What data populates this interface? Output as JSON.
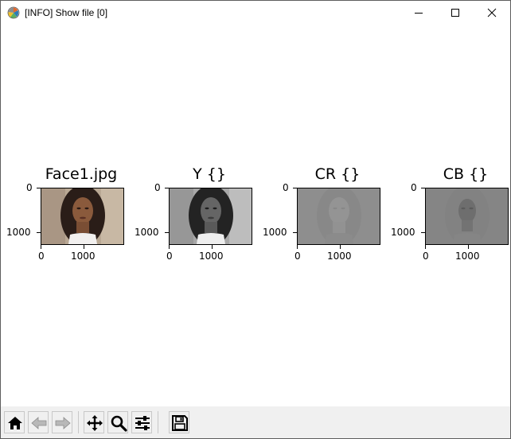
{
  "window": {
    "title": "[INFO] Show file [0]"
  },
  "subplots": [
    {
      "title": "Face1.jpg",
      "y_ticks": [
        "0",
        "1000"
      ],
      "x_ticks": [
        "0",
        "1000"
      ],
      "channel": "color"
    },
    {
      "title": "Y {}",
      "y_ticks": [
        "0",
        "1000"
      ],
      "x_ticks": [
        "0",
        "1000"
      ],
      "channel": "luma"
    },
    {
      "title": "CR {}",
      "y_ticks": [
        "0",
        "1000"
      ],
      "x_ticks": [
        "0",
        "1000"
      ],
      "channel": "chroma-red"
    },
    {
      "title": "CB {}",
      "y_ticks": [
        "0",
        "1000"
      ],
      "x_ticks": [
        "0",
        "1000"
      ],
      "channel": "chroma-blue"
    }
  ],
  "toolbar": {
    "buttons": [
      "home-icon",
      "back-arrow-icon",
      "forward-arrow-icon",
      "pan-icon",
      "zoom-icon",
      "configure-subplots-icon",
      "save-icon"
    ]
  }
}
